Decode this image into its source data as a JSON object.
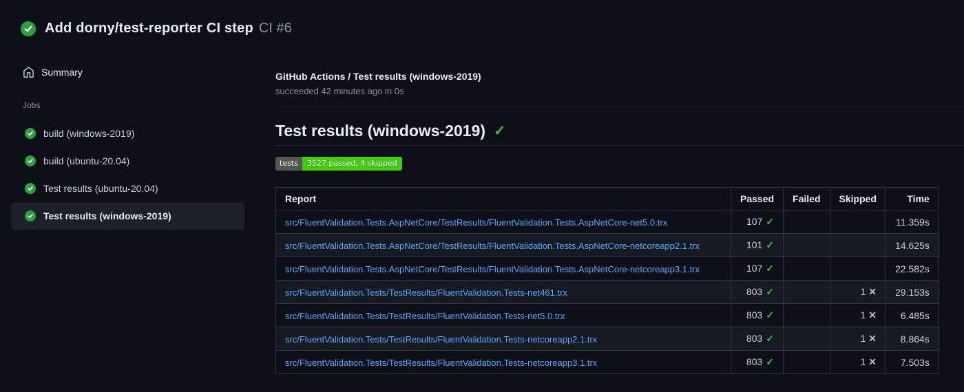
{
  "header": {
    "title": "Add dorny/test-reporter CI step",
    "run_number": "CI #6",
    "status": "success"
  },
  "sidebar": {
    "summary_label": "Summary",
    "jobs_section_label": "Jobs",
    "jobs": [
      {
        "label": "build (windows-2019)",
        "status": "success",
        "selected": false
      },
      {
        "label": "build (ubuntu-20.04)",
        "status": "success",
        "selected": false
      },
      {
        "label": "Test results (ubuntu-20.04)",
        "status": "success",
        "selected": false
      },
      {
        "label": "Test results (windows-2019)",
        "status": "success",
        "selected": true
      }
    ]
  },
  "main": {
    "run_title": "GitHub Actions / Test results (windows-2019)",
    "run_status": "succeeded 42 minutes ago in 0s",
    "section_heading": "Test results (windows-2019)",
    "heading_check": "✓",
    "badge": {
      "label": "tests",
      "value": "3527 passed, 4 skipped"
    },
    "table": {
      "headers": [
        "Report",
        "Passed",
        "Failed",
        "Skipped",
        "Time"
      ],
      "rows": [
        {
          "report": "src/FluentValidation.Tests.AspNetCore/TestResults/FluentValidation.Tests.AspNetCore-net5.0.trx",
          "passed": "107",
          "failed": "",
          "skipped": "",
          "time": "11.359s"
        },
        {
          "report": "src/FluentValidation.Tests.AspNetCore/TestResults/FluentValidation.Tests.AspNetCore-netcoreapp2.1.trx",
          "passed": "101",
          "failed": "",
          "skipped": "",
          "time": "14.625s"
        },
        {
          "report": "src/FluentValidation.Tests.AspNetCore/TestResults/FluentValidation.Tests.AspNetCore-netcoreapp3.1.trx",
          "passed": "107",
          "failed": "",
          "skipped": "",
          "time": "22.582s"
        },
        {
          "report": "src/FluentValidation.Tests/TestResults/FluentValidation.Tests-net461.trx",
          "passed": "803",
          "failed": "",
          "skipped": "1",
          "time": "29.153s"
        },
        {
          "report": "src/FluentValidation.Tests/TestResults/FluentValidation.Tests-net5.0.trx",
          "passed": "803",
          "failed": "",
          "skipped": "1",
          "time": "6.485s"
        },
        {
          "report": "src/FluentValidation.Tests/TestResults/FluentValidation.Tests-netcoreapp2.1.trx",
          "passed": "803",
          "failed": "",
          "skipped": "1",
          "time": "8.864s"
        },
        {
          "report": "src/FluentValidation.Tests/TestResults/FluentValidation.Tests-netcoreapp3.1.trx",
          "passed": "803",
          "failed": "",
          "skipped": "1",
          "time": "7.503s"
        }
      ]
    }
  },
  "colors": {
    "page_bg": "#0d1117",
    "row_stripe": "#161b22",
    "table_border": "#30363d",
    "success_green": "#2ea043",
    "check_green": "#3fb950",
    "link_blue": "#58a6ff",
    "muted_text": "#8b949e",
    "badge_label_bg": "#555555",
    "badge_value_bg": "#44cc11",
    "selected_item_bg": "#1c2128"
  }
}
